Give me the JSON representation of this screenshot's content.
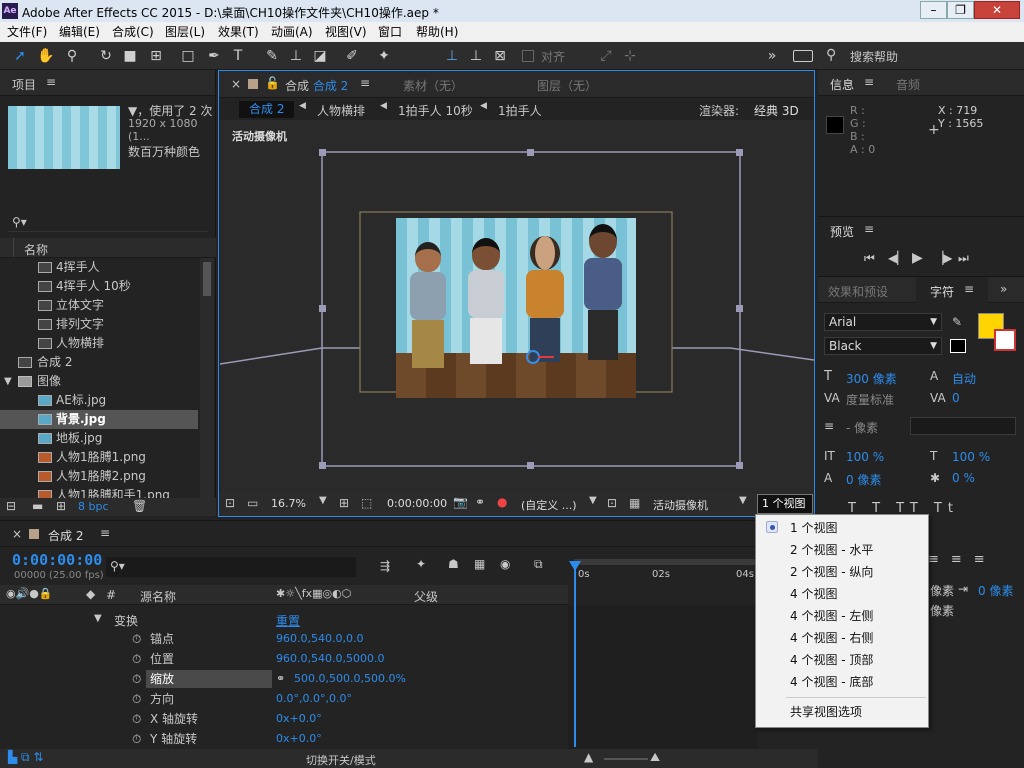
{
  "window": {
    "title": "Adobe After Effects CC 2015 - D:\\桌面\\CH10操作文件夹\\CH10操作.aep *",
    "app_icon": "Ae"
  },
  "menu": [
    "文件(F)",
    "编辑(E)",
    "合成(C)",
    "图层(L)",
    "效果(T)",
    "动画(A)",
    "视图(V)",
    "窗口",
    "帮助(H)"
  ],
  "toolbar": {
    "align_label": "对齐",
    "help_search": "搜索帮助"
  },
  "project": {
    "tab": "项目",
    "usage": "▼，使用了 2 次",
    "resolution": "1920 x 1080 (1...",
    "color": "数百万种颜色",
    "col_name": "名称",
    "items": [
      "4挥手人",
      "4挥手人 10秒",
      "立体文字",
      "排列文字",
      "人物横排",
      "合成 2",
      "图像",
      "AE标.jpg",
      "背景.jpg",
      "地板.jpg",
      "人物1胳膊1.png",
      "人物1胳膊2.png",
      "人物1胳膊和手1.png"
    ],
    "bpc": "8 bpc"
  },
  "comp": {
    "tab_close": "×",
    "tab_label": "合成",
    "tab_name": "合成 2",
    "tab_footage": "素材（无）",
    "tab_layer": "图层（无）",
    "flow": [
      "合成 2",
      "人物横排",
      "1拍手人 10秒",
      "1拍手人"
    ],
    "renderer_label": "渲染器:",
    "renderer_value": "经典 3D",
    "camera_label": "活动摄像机",
    "zoom": "16.7%",
    "timecode": "0:00:00:00",
    "resolution": "(自定义 ...)",
    "camera_select": "活动摄像机",
    "view_select": "1 个视图"
  },
  "view_dropdown": {
    "items": [
      "1 个视图",
      "2 个视图 - 水平",
      "2 个视图 - 纵向",
      "4 个视图",
      "4 个视图 - 左侧",
      "4 个视图 - 右侧",
      "4 个视图 - 顶部",
      "4 个视图 - 底部"
    ],
    "selected_index": 0,
    "shared": "共享视图选项"
  },
  "info": {
    "tab": "信息",
    "tab_audio": "音频",
    "r": "R :",
    "g": "G :",
    "b": "B :",
    "a": "A : 0",
    "x": "X : 719",
    "y": "Y : 1565"
  },
  "preview": {
    "tab": "预览"
  },
  "effects": {
    "tab": "效果和预设",
    "tab_char": "字符"
  },
  "character": {
    "font": "Arial",
    "style": "Black",
    "size": "300 像素",
    "leading": "自动",
    "kerning": "度量标准",
    "tracking": "0",
    "stroke": "- 像素",
    "vscale": "100 %",
    "hscale": "100 %",
    "baseline": "0 像素",
    "tsume": "0 %",
    "indent_a": "像素",
    "indent_b": "0 像素",
    "indent_c": "像素",
    "accent": "#ffd400"
  },
  "timeline": {
    "tab": "合成 2",
    "timecode": "0:00:00:00",
    "frames": "00000 (25.00 fps)",
    "col_source": "源名称",
    "col_parent": "父级",
    "col_num": "#",
    "ruler": [
      "0s",
      "02s",
      "04s"
    ],
    "transform": "变换",
    "reset": "重置",
    "props": [
      {
        "name": "锚点",
        "value": "960.0,540.0,0.0"
      },
      {
        "name": "位置",
        "value": "960.0,540.0,5000.0"
      },
      {
        "name": "缩放",
        "value": "500.0,500.0,500.0%"
      },
      {
        "name": "方向",
        "value": "0.0°,0.0°,0.0°"
      },
      {
        "name": "X 轴旋转",
        "value": "0x+0.0°"
      },
      {
        "name": "Y 轴旋转",
        "value": "0x+0.0°"
      }
    ],
    "toggle": "切换开关/模式"
  }
}
